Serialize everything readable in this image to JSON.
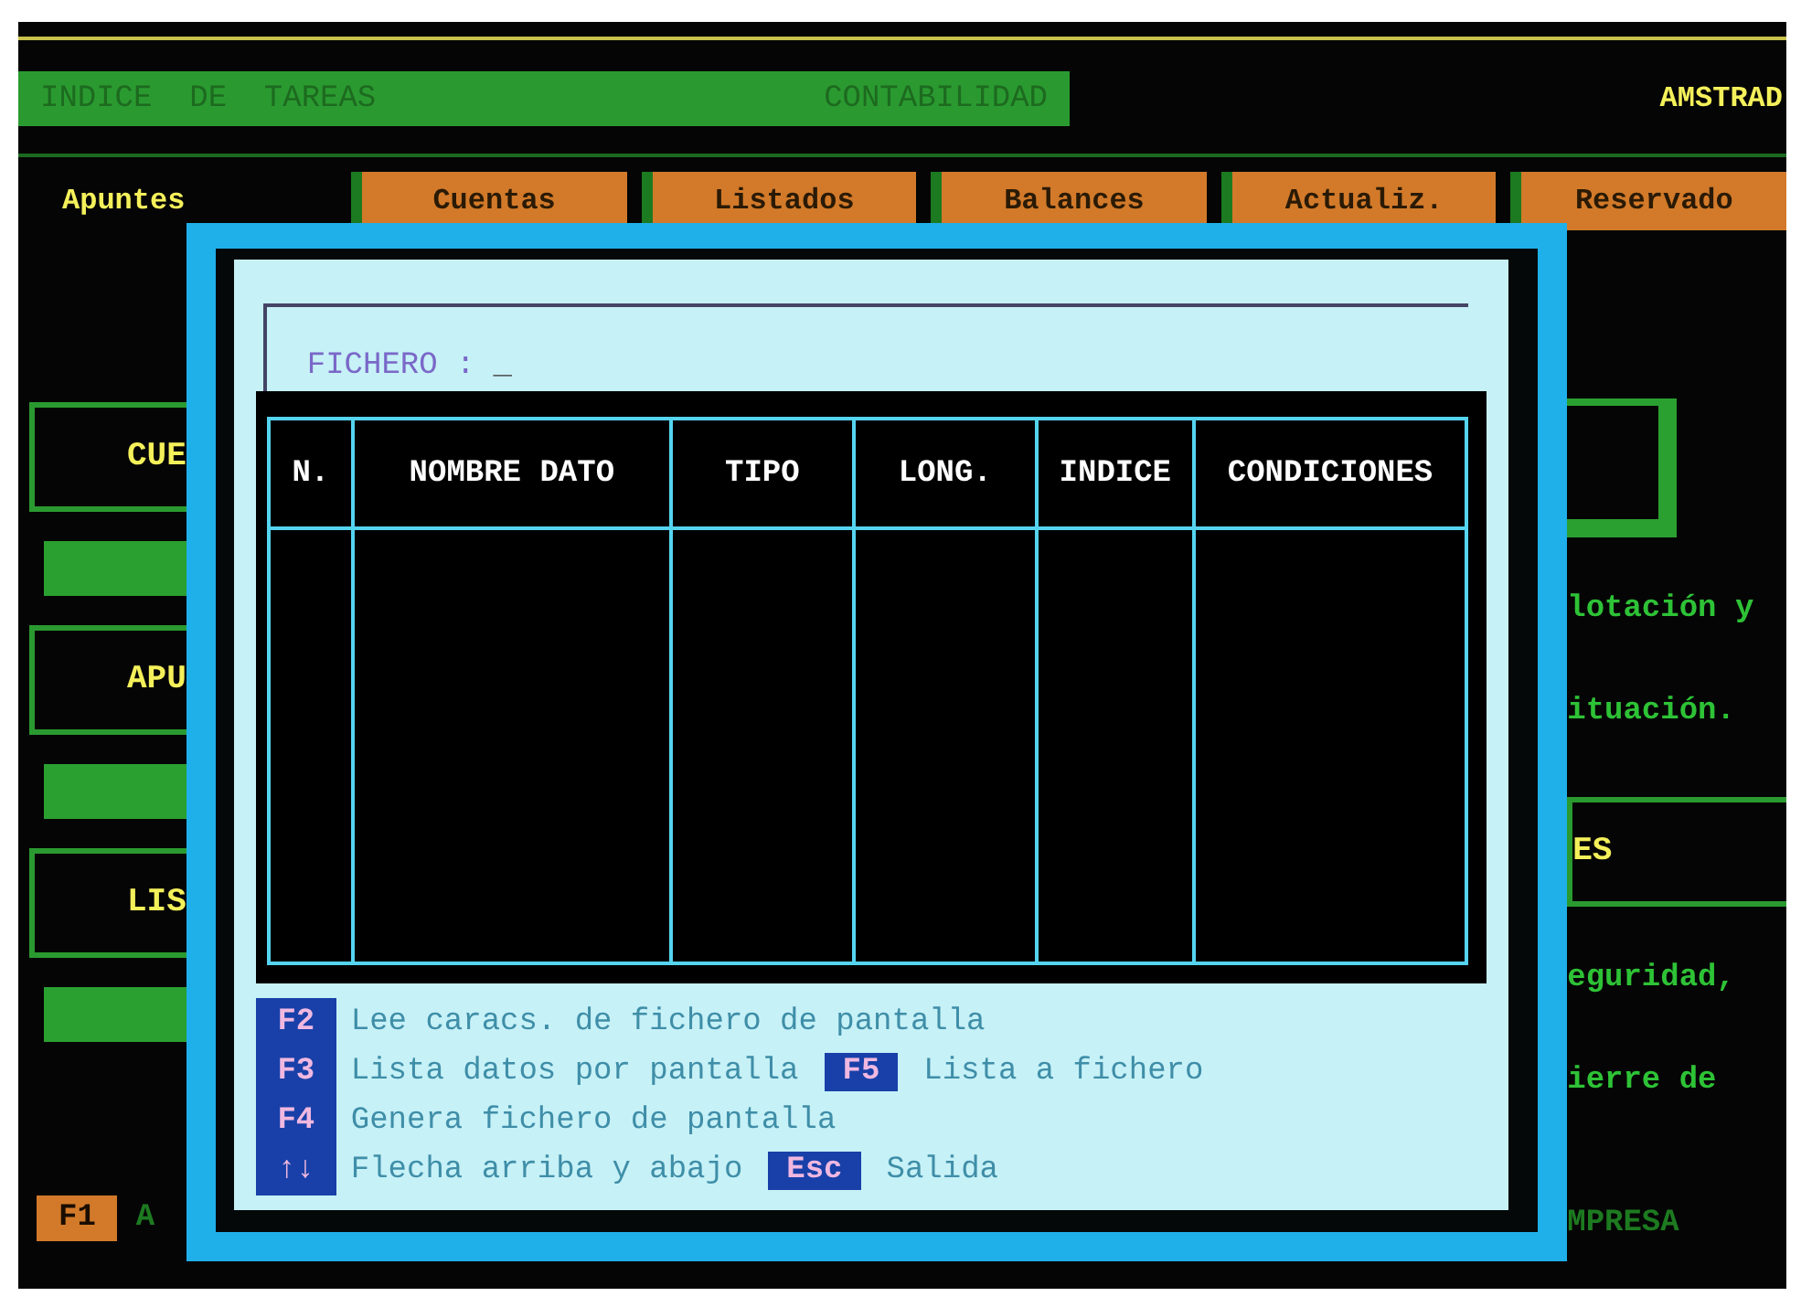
{
  "header": {
    "title": "INDICE  DE  TAREAS",
    "module": "CONTABILIDAD",
    "brand": "AMSTRAD"
  },
  "menu": [
    {
      "label": "Apuntes",
      "selected": true
    },
    {
      "label": "Cuentas",
      "selected": false
    },
    {
      "label": "Listados",
      "selected": false
    },
    {
      "label": "Balances",
      "selected": false
    },
    {
      "label": "Actualiz.",
      "selected": false
    },
    {
      "label": "Reservado",
      "selected": false
    }
  ],
  "left_column": [
    {
      "kind": "box",
      "label": "CUE"
    },
    {
      "kind": "bar"
    },
    {
      "kind": "box",
      "label": "APU"
    },
    {
      "kind": "bar"
    },
    {
      "kind": "box",
      "label": "LIS"
    },
    {
      "kind": "bar"
    }
  ],
  "right_column": [
    {
      "kind": "frame"
    },
    {
      "kind": "text",
      "text": "lotación y"
    },
    {
      "kind": "text",
      "text": "ituación."
    },
    {
      "kind": "box",
      "label": "ES"
    },
    {
      "kind": "text",
      "text": "eguridad,"
    },
    {
      "kind": "text",
      "text": "ierre de"
    }
  ],
  "status_bar": {
    "key": "F1",
    "left_text": "A",
    "right_text": "MPRESA"
  },
  "dialog": {
    "field_label": "FICHERO :",
    "cursor": "_",
    "columns": [
      "N.",
      "NOMBRE DATO",
      "TIPO",
      "LONG.",
      "INDICE",
      "CONDICIONES"
    ],
    "keys": [
      {
        "key": "F2",
        "text": "Lee caracs. de fichero de pantalla"
      },
      {
        "key": "F3",
        "text": "Lista datos por pantalla",
        "extra_key": "F5",
        "extra_text": "Lista a fichero"
      },
      {
        "key": "F4",
        "text": "Genera fichero de pantalla"
      },
      {
        "key": "↑↓",
        "text": "Flecha arriba y abajo",
        "extra_key": "Esc",
        "extra_text": "Salida"
      }
    ]
  }
}
